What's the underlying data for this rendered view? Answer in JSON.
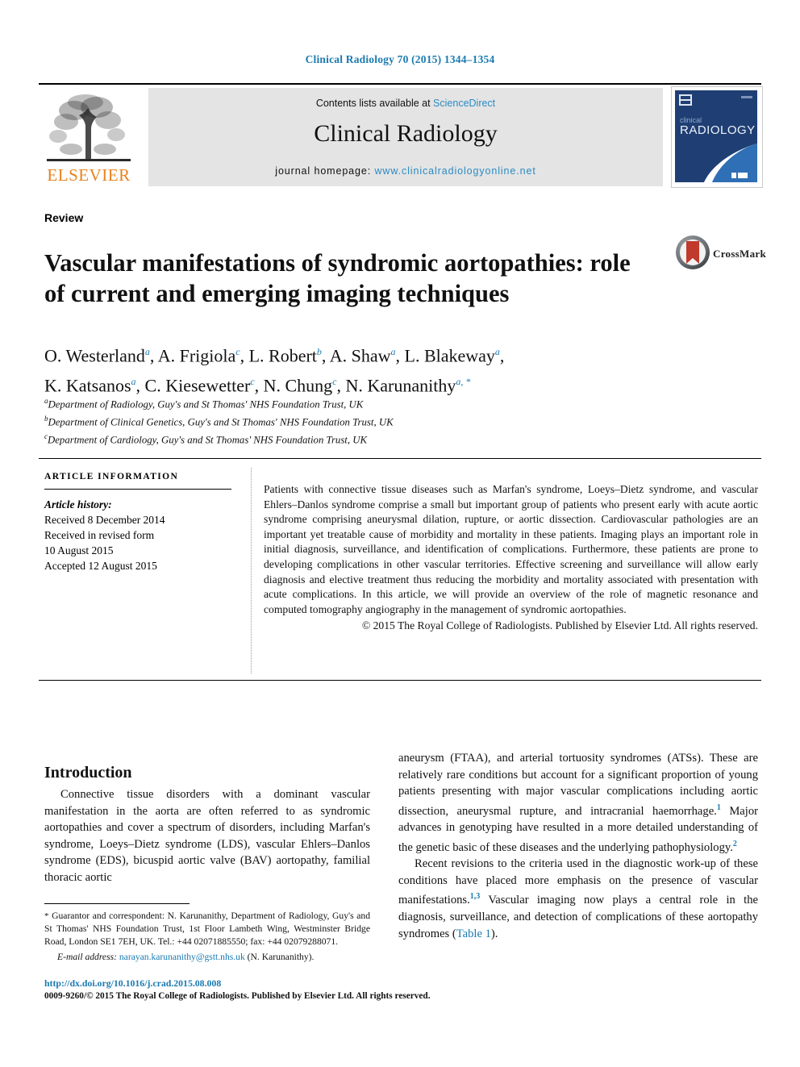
{
  "running_head": "Clinical Radiology 70 (2015) 1344–1354",
  "masthead": {
    "contents_prefix": "Contents lists available at ",
    "sciencedirect": "ScienceDirect",
    "journal_title": "Clinical Radiology",
    "homepage_prefix": "journal homepage: ",
    "homepage_url": "www.clinicalradiologyonline.net",
    "publisher_logo_text": "ELSEVIER",
    "cover_title_small": "clinical",
    "cover_title_large": "RADIOLOGY",
    "accent_blue": "#2b8bc4",
    "elsevier_orange": "#e8821e"
  },
  "article": {
    "doctype": "Review",
    "title": "Vascular manifestations of syndromic aortopathies: role of current and emerging imaging techniques",
    "crossmark_label": "CrossMark",
    "authors": [
      {
        "name": "O. Westerland",
        "sup": "a",
        "sep": ", "
      },
      {
        "name": "A. Frigiola",
        "sup": "c",
        "sep": ", "
      },
      {
        "name": "L. Robert",
        "sup": "b",
        "sep": ", "
      },
      {
        "name": "A. Shaw",
        "sup": "a",
        "sep": ", "
      },
      {
        "name": "L. Blakeway",
        "sup": "a",
        "sep": ","
      },
      {
        "name": "K. Katsanos",
        "sup": "a",
        "sep": ", "
      },
      {
        "name": "C. Kiesewetter",
        "sup": "c",
        "sep": ", "
      },
      {
        "name": "N. Chung",
        "sup": "c",
        "sep": ", "
      },
      {
        "name": "N. Karunanithy",
        "sup": "a, *",
        "sep": ""
      }
    ],
    "affiliations": [
      {
        "mark": "a",
        "text": "Department of Radiology, Guy's and St Thomas' NHS Foundation Trust, UK"
      },
      {
        "mark": "b",
        "text": "Department of Clinical Genetics, Guy's and St Thomas' NHS Foundation Trust, UK"
      },
      {
        "mark": "c",
        "text": "Department of Cardiology, Guy's and St Thomas' NHS Foundation Trust, UK"
      }
    ]
  },
  "article_information": {
    "heading": "ARTICLE INFORMATION",
    "history_label": "Article history:",
    "history": [
      "Received 8 December 2014",
      "Received in revised form",
      "10 August 2015",
      "Accepted 12 August 2015"
    ]
  },
  "abstract": {
    "body": "Patients with connective tissue diseases such as Marfan's syndrome, Loeys–Dietz syndrome, and vascular Ehlers–Danlos syndrome comprise a small but important group of patients who present early with acute aortic syndrome comprising aneurysmal dilation, rupture, or aortic dissection. Cardiovascular pathologies are an important yet treatable cause of morbidity and mortality in these patients. Imaging plays an important role in initial diagnosis, surveillance, and identification of complications. Furthermore, these patients are prone to developing complications in other vascular territories. Effective screening and surveillance will allow early diagnosis and elective treatment thus reducing the morbidity and mortality associated with presentation with acute complications. In this article, we will provide an overview of the role of magnetic resonance and computed tomography angiography in the management of syndromic aortopathies.",
    "copyright": "© 2015 The Royal College of Radiologists. Published by Elsevier Ltd. All rights reserved."
  },
  "body": {
    "section_heading": "Introduction",
    "left_paragraph": "Connective tissue disorders with a dominant vascular manifestation in the aorta are often referred to as syndromic aortopathies and cover a spectrum of disorders, including Marfan's syndrome, Loeys–Dietz syndrome (LDS), vascular Ehlers–Danlos syndrome (EDS), bicuspid aortic valve (BAV) aortopathy, familial thoracic aortic",
    "right_paragraph_1_a": "aneurysm (FTAA), and arterial tortuosity syndromes (ATSs). These are relatively rare conditions but account for a significant proportion of young patients presenting with major vascular complications including aortic dissection, aneurysmal rupture, and intracranial haemorrhage.",
    "right_paragraph_1_ref1": "1",
    "right_paragraph_1_b": " Major advances in genotyping have resulted in a more detailed understanding of the genetic basic of these diseases and the underlying pathophysiology.",
    "right_paragraph_1_ref2": "2",
    "right_paragraph_2_a": "Recent revisions to the criteria used in the diagnostic work-up of these conditions have placed more emphasis on the presence of vascular manifestations.",
    "right_paragraph_2_ref": "1,3",
    "right_paragraph_2_b": " Vascular imaging now plays a central role in the diagnosis, surveillance, and detection of complications of these aortopathy syndromes (",
    "right_paragraph_2_link": "Table 1",
    "right_paragraph_2_c": ")."
  },
  "footnotes": {
    "correspondence_star": "*",
    "correspondence": " Guarantor and correspondent: N. Karunanithy, Department of Radiology, Guy's and St Thomas' NHS Foundation Trust, 1st Floor Lambeth Wing, Westminster Bridge Road, London SE1 7EH, UK. Tel.: +44 02071885550; fax: +44 02079288071.",
    "email_label": "E-mail address:",
    "email_address": "narayan.karunanithy@gstt.nhs.uk",
    "email_suffix": " (N. Karunanithy).",
    "doi_url": "http://dx.doi.org/10.1016/j.crad.2015.08.008",
    "issn_line": "0009-9260/© 2015 The Royal College of Radiologists. Published by Elsevier Ltd. All rights reserved."
  }
}
